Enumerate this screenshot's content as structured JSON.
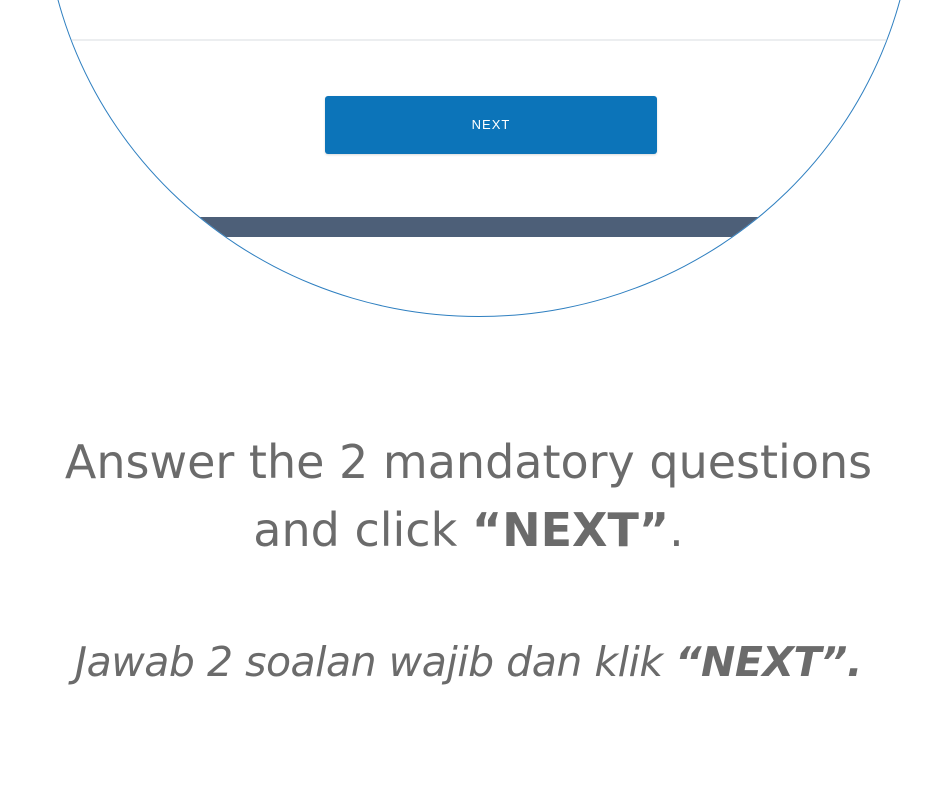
{
  "zoom_callout": {
    "button_label": "NEXT"
  },
  "instructions": {
    "english": {
      "line1": "Answer the 2 mandatory questions",
      "line2_prefix": "and click ",
      "line2_emphasis": "“NEXT”",
      "line2_suffix": "."
    },
    "malay": {
      "prefix": "Jawab 2 soalan wajib dan klik ",
      "emphasis": "“NEXT”."
    }
  },
  "colors": {
    "circle_border": "#2e7fc0",
    "button_bg": "#0c74b9",
    "footer_bar": "#4d5f78",
    "text": "#6b6b6b"
  }
}
